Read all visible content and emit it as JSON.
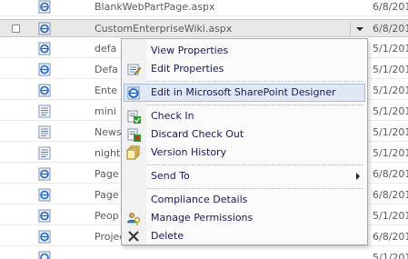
{
  "files": [
    {
      "name": "BlankWebPartPage.aspx",
      "date": "6/8/201"
    },
    {
      "name": "CustomEnterpriseWiki.aspx",
      "date": "6/8/201"
    },
    {
      "name": "defa",
      "date": "5/1/201"
    },
    {
      "name": "Defa",
      "date": "5/1/201"
    },
    {
      "name": "Ente",
      "date": "5/1/201"
    },
    {
      "name": "mini",
      "date": "5/1/201"
    },
    {
      "name": "News",
      "date": "5/1/201"
    },
    {
      "name": "night",
      "date": "5/1/201"
    },
    {
      "name": "Page",
      "date": "6/8/201"
    },
    {
      "name": "Page",
      "date": "6/8/201"
    },
    {
      "name": "Peop",
      "date": "5/1/201"
    },
    {
      "name": "ProjectPage.aspx",
      "date": "6/8/201"
    },
    {
      "name": "",
      "date": "5/1/201"
    }
  ],
  "menu": {
    "items": [
      {
        "label": "View Properties",
        "icon": "none"
      },
      {
        "label": "Edit Properties",
        "icon": "edit-properties-icon"
      },
      {
        "label": "Edit in Microsoft SharePoint Designer",
        "icon": "sharepoint-designer-icon",
        "highlighted": true
      },
      {
        "label": "Check In",
        "icon": "check-in-icon"
      },
      {
        "label": "Discard Check Out",
        "icon": "discard-checkout-icon"
      },
      {
        "label": "Version History",
        "icon": "version-history-icon"
      },
      {
        "label": "Send To",
        "icon": "none",
        "submenu": true
      },
      {
        "label": "Compliance Details",
        "icon": "none"
      },
      {
        "label": "Manage Permissions",
        "icon": "manage-permissions-icon"
      },
      {
        "label": "Delete",
        "icon": "delete-icon"
      }
    ]
  },
  "colors": {
    "highlight_bg": "#dfe8f4",
    "highlight_border": "#a4bdde",
    "menu_text": "#1a1a5a",
    "ie_blue": "#1f63c6"
  }
}
